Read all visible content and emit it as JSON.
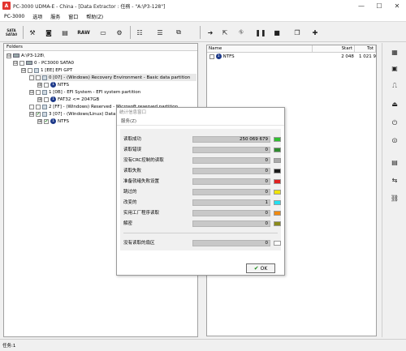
{
  "window": {
    "title": "PC-3000 UDMA-E - China - [Data Extractor : 任務 - \"A:\\P3-128\"]",
    "app_icon_letter": "A",
    "minimize": "—",
    "maximize": "☐",
    "close": "✕"
  },
  "menu": [
    "PC-3000",
    "选项",
    "服务",
    "窗口",
    "帮助(Z)"
  ],
  "toolbar": {
    "sata_line1": "SATA",
    "sata_line2": "SATA0",
    "raw_label": "RAW"
  },
  "left_panel": {
    "header": "Folders",
    "tree": [
      {
        "text": "A:\\P3-128\\",
        "expander": "⊟"
      },
      {
        "text": "0 - PC3000 SATA0",
        "expander": "⊟"
      },
      {
        "text": "1 [EE] EFI GPT",
        "expander": "⊟"
      },
      {
        "text": "0 [07] - (Windows) Recovery Environment - Basic data partition",
        "expander": ""
      },
      {
        "text": "NTFS",
        "expander": "⊞",
        "fs": "1"
      },
      {
        "text": "1 [0B] - EFI System - EFI system partition",
        "expander": "⊟"
      },
      {
        "text": "FAT32 <= 2047GB",
        "expander": "⊞",
        "fs": "1"
      },
      {
        "text": "2 [FF] - (Windows) Reserved - Microsoft reserved partition",
        "expander": ""
      },
      {
        "text": "3 [07] - (Windows/Linux) Data -",
        "expander": "⊟"
      },
      {
        "text": "NTFS",
        "expander": "⊞",
        "fs": "1"
      }
    ]
  },
  "right_panel": {
    "columns": [
      "Name",
      "Start",
      "Tot"
    ],
    "rows": [
      {
        "name": "NTFS",
        "fs": "1",
        "start": "2 048",
        "tot": "1 021 9"
      }
    ]
  },
  "dialog": {
    "title": "统计信息窗口",
    "menu": "服务(Z)",
    "ok_label": "OK",
    "ok_check": "✔",
    "stats": [
      {
        "label": "读取成功",
        "value": "250 069 679",
        "color": "#2fbf2f"
      },
      {
        "label": "读取错误",
        "value": "0",
        "color": "#2e8b2e"
      },
      {
        "label": "没有CRC控制的读取",
        "value": "0",
        "color": "#aaaaaa"
      },
      {
        "label": "读取失败",
        "value": "0",
        "color": "#1a1a1a"
      },
      {
        "label": "准备就绪失败设置",
        "value": "0",
        "color": "#e02020"
      },
      {
        "label": "跳过的",
        "value": "0",
        "color": "#f0e400"
      },
      {
        "label": "改变的",
        "value": "1",
        "color": "#22e0f0"
      },
      {
        "label": "实用工厂程序读取",
        "value": "0",
        "color": "#f08a10"
      },
      {
        "label": "解密",
        "value": "0",
        "color": "#8a8a1a"
      }
    ],
    "unread": {
      "label": "没有读取的扇区",
      "value": "0",
      "color": "#ffffff"
    }
  },
  "statusbar": {
    "text": "任务:1"
  }
}
